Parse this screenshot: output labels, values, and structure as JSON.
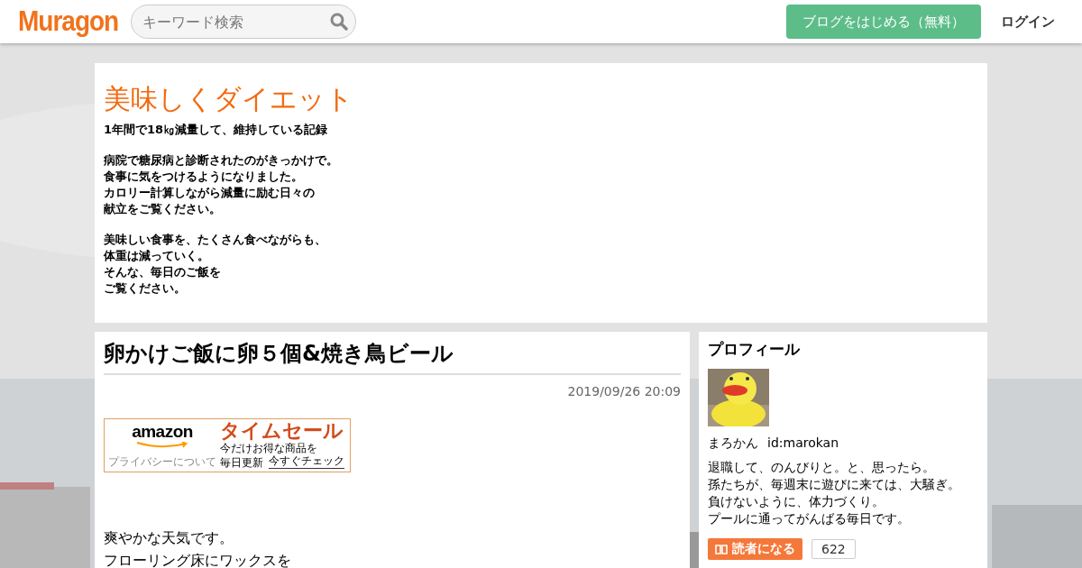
{
  "header": {
    "logo": "Muragon",
    "search": {
      "placeholder": "キーワード検索"
    },
    "start_button": "ブログをはじめる（無料）",
    "login": "ログイン"
  },
  "blog": {
    "title": "美味しくダイエット",
    "subtitle": "1年間で18㎏減量して、維持している記録",
    "paragraphs": [
      [
        "病院で糖尿病と診断されたのがきっかけで。",
        "食事に気をつけるようになりました。",
        "カロリー計算しながら減量に励む日々の",
        "献立をご覧ください。"
      ],
      [
        "美味しい食事を、たくさん食べながらも、",
        "体重は減っていく。",
        "そんな、毎日のご飯を",
        "ご覧ください。"
      ]
    ]
  },
  "article": {
    "title": "卵かけご飯に卵５個&焼き鳥ビール",
    "date": "2019/09/26 20:09",
    "ad": {
      "brand": "amazon",
      "headline": "タイムセール",
      "text": [
        "今だけお得な商品を",
        "毎日更新"
      ],
      "link": "今すぐチェック",
      "privacy": "プライバシーについて"
    },
    "body": [
      "爽やかな天気です。",
      "フローリング床にワックスを"
    ]
  },
  "profile": {
    "heading": "プロフィール",
    "name": "まろかん",
    "id": "id:marokan",
    "bio": [
      "退職して、のんびりと。と、思ったら。",
      "孫たちが、毎週末に遊びに来ては、大騒ぎ。",
      "負けないように、体力づくり。",
      "プールに通ってがんばる毎日です。"
    ],
    "follow_button": "読者になる",
    "follower_count": "622"
  }
}
